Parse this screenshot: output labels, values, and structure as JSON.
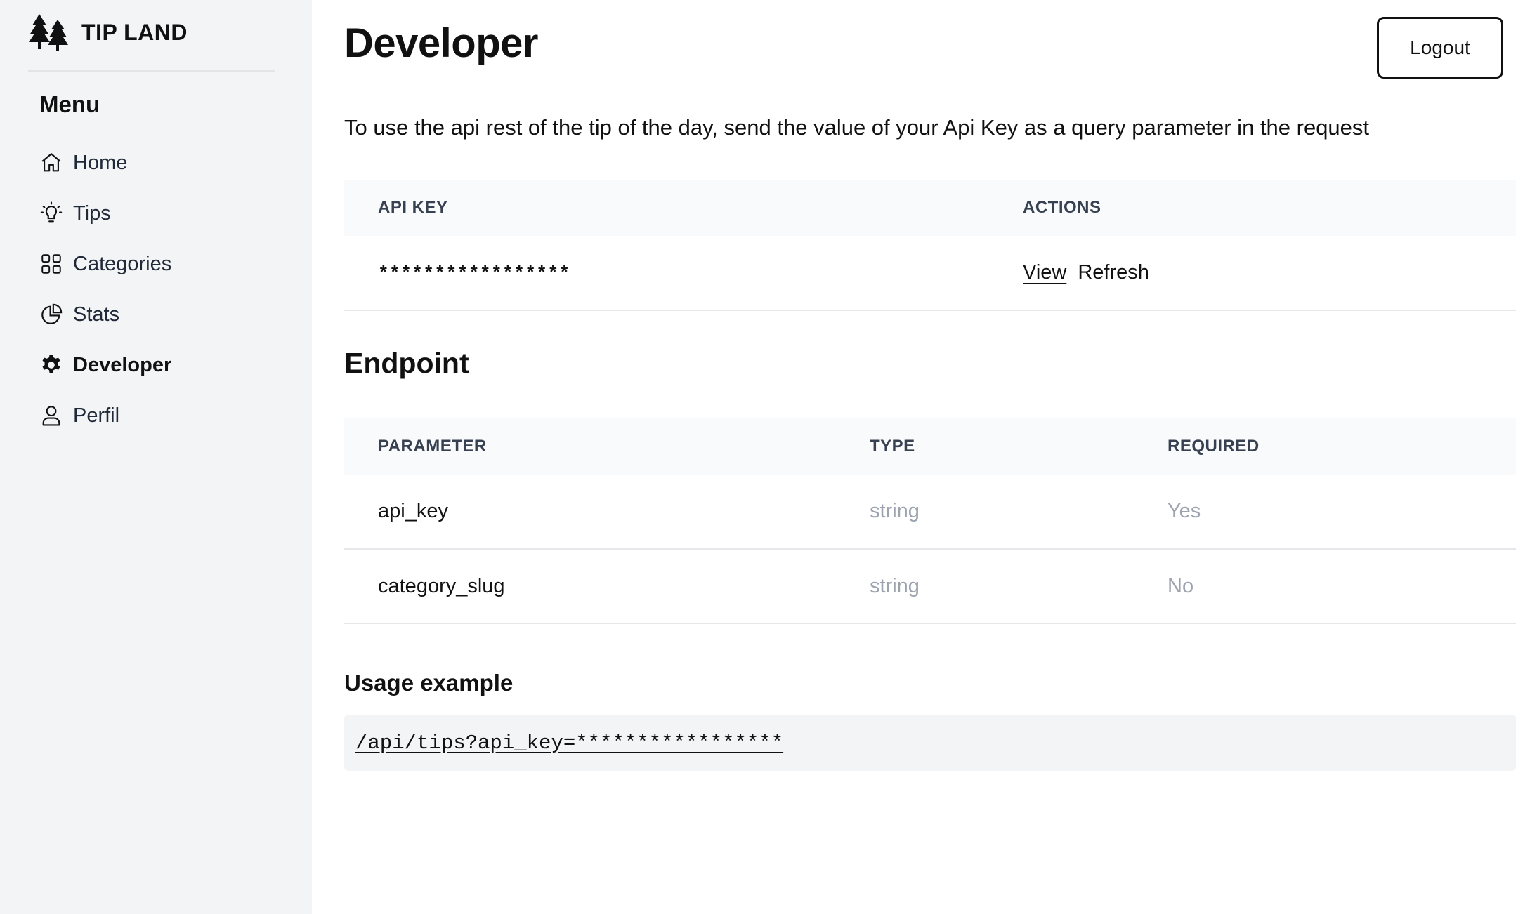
{
  "brand": {
    "name": "TIP LAND"
  },
  "sidebar": {
    "menu_title": "Menu",
    "items": [
      {
        "label": "Home",
        "icon": "home-icon"
      },
      {
        "label": "Tips",
        "icon": "lightbulb-icon"
      },
      {
        "label": "Categories",
        "icon": "grid-icon"
      },
      {
        "label": "Stats",
        "icon": "pie-chart-icon"
      },
      {
        "label": "Developer",
        "icon": "gear-icon",
        "active": true
      },
      {
        "label": "Perfil",
        "icon": "user-icon"
      }
    ]
  },
  "header": {
    "title": "Developer",
    "logout_label": "Logout"
  },
  "intro_text": "To use the api rest of the tip of the day, send the value of your Api Key as a query parameter in the request",
  "api_key_table": {
    "headers": [
      "API KEY",
      "ACTIONS"
    ],
    "masked_key": "*****************",
    "actions": {
      "view": "View",
      "refresh": "Refresh"
    }
  },
  "endpoint": {
    "title": "Endpoint",
    "headers": [
      "PARAMETER",
      "TYPE",
      "REQUIRED"
    ],
    "rows": [
      {
        "parameter": "api_key",
        "type": "string",
        "required": "Yes"
      },
      {
        "parameter": "category_slug",
        "type": "string",
        "required": "No"
      }
    ]
  },
  "usage": {
    "title": "Usage example",
    "example": "/api/tips?api_key=*****************"
  },
  "colors": {
    "sidebar_bg": "#f3f4f6",
    "table_header_bg": "#f9fafb",
    "muted_text": "#9ca3af"
  }
}
